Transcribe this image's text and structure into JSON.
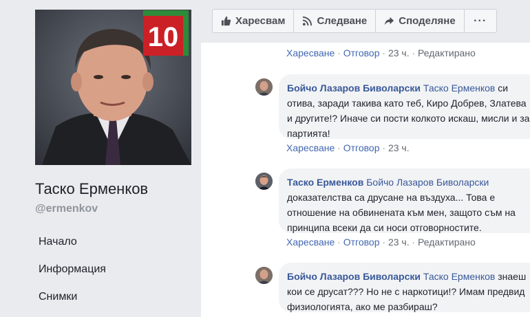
{
  "colors": {
    "link": "#4267b2",
    "author": "#385898",
    "meta": "#616770",
    "background": "#e9ebee",
    "badge_red": "#cc2027",
    "badge_green": "#2e8b3a"
  },
  "profile": {
    "name": "Таско Ерменков",
    "handle": "@ermenkov",
    "badge_number": "10"
  },
  "nav": [
    "Начало",
    "Информация",
    "Снимки"
  ],
  "actions": {
    "like": {
      "label": "Харесвам",
      "icon": "thumbs-up-icon"
    },
    "follow": {
      "label": "Следване",
      "icon": "rss-icon"
    },
    "share": {
      "label": "Споделяне",
      "icon": "share-arrow-icon"
    },
    "more": {
      "label": "···",
      "icon": "more-dots-icon"
    }
  },
  "comments": {
    "top_meta": {
      "like": "Харесване",
      "reply": "Отговор",
      "time": "23 ч.",
      "edited": "Редактирано"
    },
    "items": [
      {
        "author": "Бойчо Лазаров Биволарски",
        "mention": "Таско Ерменков",
        "text": "си отива, заради такива като теб, Киро Добрев, Златева и другите!? Иначе си пости колкото искаш, мисли и за партията!",
        "meta": {
          "like": "Харесване",
          "reply": "Отговор",
          "time": "23 ч.",
          "edited": ""
        }
      },
      {
        "author": "Таско Ерменков",
        "mention": "Бойчо Лазаров Биволарски",
        "text": "доказателства са друсане на въздуха... Това е отношение на обвинената към мен, защото съм на принципа всеки да си носи отговорностите.",
        "meta": {
          "like": "Харесване",
          "reply": "Отговор",
          "time": "23 ч.",
          "edited": "Редактирано"
        }
      },
      {
        "author": "Бойчо Лазаров Биволарски",
        "mention": "Таско Ерменков",
        "text": "знаеш кои се друсат??? Но не с наркотици!? Имам предвид физиологията, ако ме разбираш?",
        "meta": {
          "like": "",
          "reply": "",
          "time": "",
          "edited": ""
        }
      }
    ]
  }
}
